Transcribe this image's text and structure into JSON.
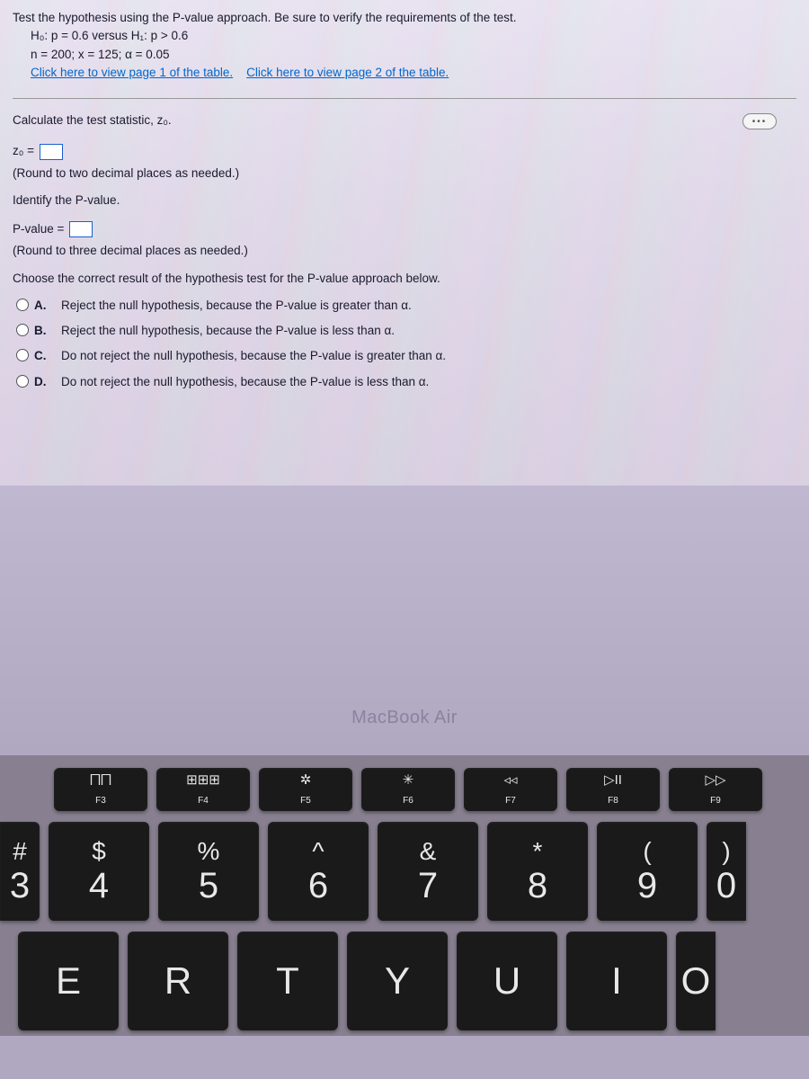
{
  "problem": {
    "intro": "Test the hypothesis using the P-value approach. Be sure to verify the requirements of the test.",
    "h0": "H₀: p = 0.6 versus H₁: p > 0.6",
    "params": "n = 200; x = 125; α = 0.05",
    "link1": "Click here to view page 1 of the table.",
    "link2": "Click here to view page 2 of the table."
  },
  "q1": {
    "prompt": "Calculate the test statistic, z₀.",
    "label": "z₀ =",
    "hint": "(Round to two decimal places as needed.)"
  },
  "q2": {
    "prompt": "Identify the P-value.",
    "label": "P-value =",
    "hint": "(Round to three decimal places as needed.)"
  },
  "q3": {
    "prompt": "Choose the correct result of the hypothesis test for the P-value approach below.",
    "options": [
      {
        "letter": "A.",
        "text": "Reject the null hypothesis, because the P-value is greater than α."
      },
      {
        "letter": "B.",
        "text": "Reject the null hypothesis, because the P-value is less than α."
      },
      {
        "letter": "C.",
        "text": "Do not reject the null hypothesis, because the P-value is greater than α."
      },
      {
        "letter": "D.",
        "text": "Do not reject the null hypothesis, because the P-value is less than α."
      }
    ]
  },
  "more_label": "•••",
  "device_label": "MacBook Air",
  "keyboard": {
    "fn": [
      {
        "icon": "⨅⨅",
        "label": "F3",
        "name": "f3-key"
      },
      {
        "icon": "⊞⊞⊞",
        "label": "F4",
        "name": "f4-key"
      },
      {
        "icon": "✲",
        "label": "F5",
        "name": "f5-key"
      },
      {
        "icon": "✳",
        "label": "F6",
        "name": "f6-key"
      },
      {
        "icon": "◃◃",
        "label": "F7",
        "name": "f7-key"
      },
      {
        "icon": "▷II",
        "label": "F8",
        "name": "f8-key"
      },
      {
        "icon": "▷▷",
        "label": "F9",
        "name": "f9-key"
      }
    ],
    "num": [
      {
        "sym": "#",
        "num": "3",
        "name": "key-3"
      },
      {
        "sym": "$",
        "num": "4",
        "name": "key-4"
      },
      {
        "sym": "%",
        "num": "5",
        "name": "key-5"
      },
      {
        "sym": "^",
        "num": "6",
        "name": "key-6"
      },
      {
        "sym": "&",
        "num": "7",
        "name": "key-7"
      },
      {
        "sym": "*",
        "num": "8",
        "name": "key-8"
      },
      {
        "sym": "(",
        "num": "9",
        "name": "key-9"
      },
      {
        "sym": ")",
        "num": "0",
        "name": "key-0"
      }
    ],
    "letters": [
      {
        "ch": "E",
        "name": "key-e"
      },
      {
        "ch": "R",
        "name": "key-r"
      },
      {
        "ch": "T",
        "name": "key-t"
      },
      {
        "ch": "Y",
        "name": "key-y"
      },
      {
        "ch": "U",
        "name": "key-u"
      },
      {
        "ch": "I",
        "name": "key-i"
      },
      {
        "ch": "O",
        "name": "key-o"
      }
    ]
  }
}
